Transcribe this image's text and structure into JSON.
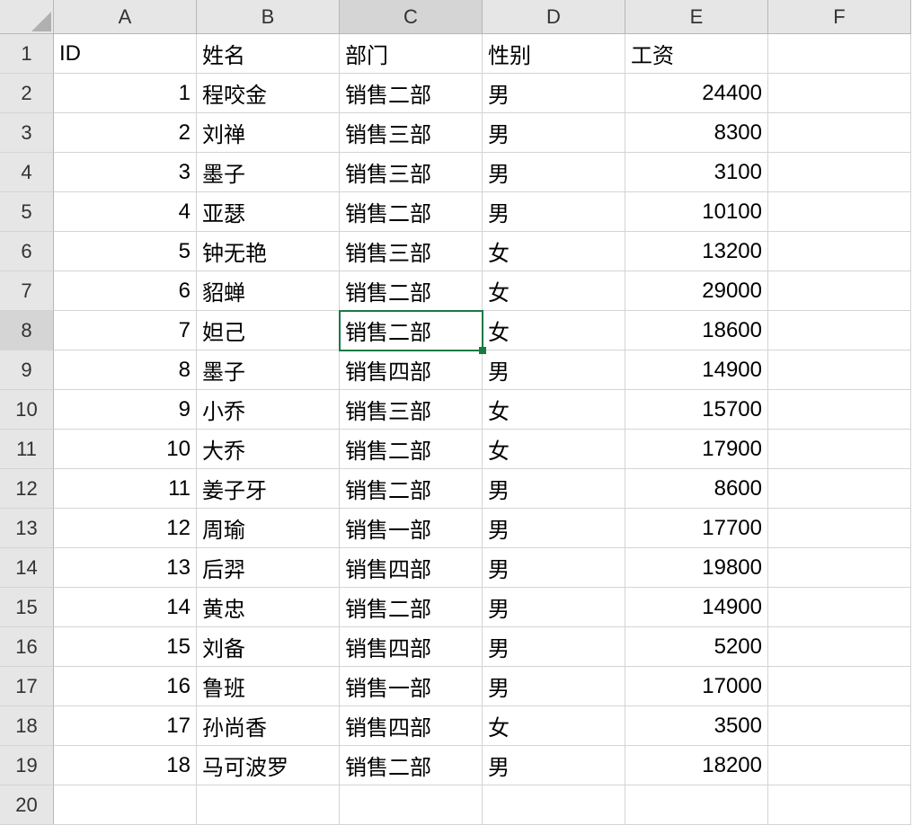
{
  "columns": [
    "A",
    "B",
    "C",
    "D",
    "E",
    "F"
  ],
  "selected_col": "C",
  "selected_row": 8,
  "active_cell": {
    "col": 2,
    "row": 8
  },
  "headers": {
    "A": "ID",
    "B": "姓名",
    "C": "部门",
    "D": "性别",
    "E": "工资",
    "F": ""
  },
  "rows": [
    {
      "id": 1,
      "name": "程咬金",
      "dept": "销售二部",
      "gender": "男",
      "salary": 24400
    },
    {
      "id": 2,
      "name": "刘禅",
      "dept": "销售三部",
      "gender": "男",
      "salary": 8300
    },
    {
      "id": 3,
      "name": "墨子",
      "dept": "销售三部",
      "gender": "男",
      "salary": 3100
    },
    {
      "id": 4,
      "name": "亚瑟",
      "dept": "销售二部",
      "gender": "男",
      "salary": 10100
    },
    {
      "id": 5,
      "name": "钟无艳",
      "dept": "销售三部",
      "gender": "女",
      "salary": 13200
    },
    {
      "id": 6,
      "name": "貂蝉",
      "dept": "销售二部",
      "gender": "女",
      "salary": 29000
    },
    {
      "id": 7,
      "name": "妲己",
      "dept": "销售二部",
      "gender": "女",
      "salary": 18600
    },
    {
      "id": 8,
      "name": "墨子",
      "dept": "销售四部",
      "gender": "男",
      "salary": 14900
    },
    {
      "id": 9,
      "name": "小乔",
      "dept": "销售三部",
      "gender": "女",
      "salary": 15700
    },
    {
      "id": 10,
      "name": "大乔",
      "dept": "销售二部",
      "gender": "女",
      "salary": 17900
    },
    {
      "id": 11,
      "name": "姜子牙",
      "dept": "销售二部",
      "gender": "男",
      "salary": 8600
    },
    {
      "id": 12,
      "name": "周瑜",
      "dept": "销售一部",
      "gender": "男",
      "salary": 17700
    },
    {
      "id": 13,
      "name": "后羿",
      "dept": "销售四部",
      "gender": "男",
      "salary": 19800
    },
    {
      "id": 14,
      "name": "黄忠",
      "dept": "销售二部",
      "gender": "男",
      "salary": 14900
    },
    {
      "id": 15,
      "name": "刘备",
      "dept": "销售四部",
      "gender": "男",
      "salary": 5200
    },
    {
      "id": 16,
      "name": "鲁班",
      "dept": "销售一部",
      "gender": "男",
      "salary": 17000
    },
    {
      "id": 17,
      "name": "孙尚香",
      "dept": "销售四部",
      "gender": "女",
      "salary": 3500
    },
    {
      "id": 18,
      "name": "马可波罗",
      "dept": "销售二部",
      "gender": "男",
      "salary": 18200
    }
  ],
  "total_visible_rows": 20
}
